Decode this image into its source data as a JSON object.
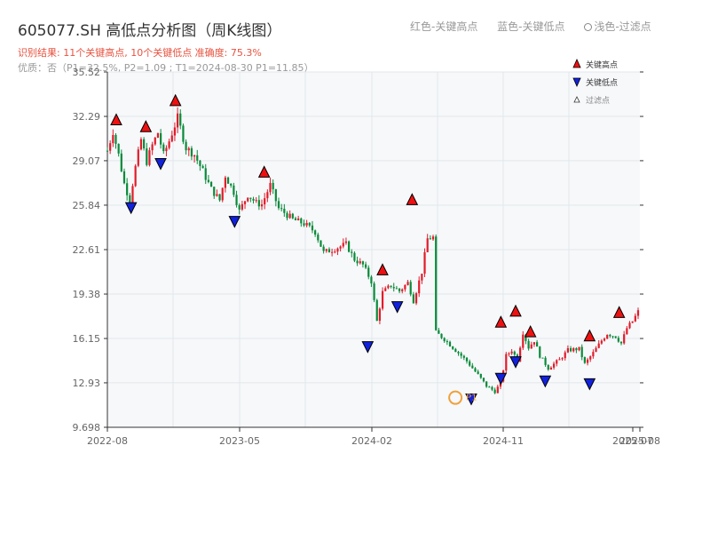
{
  "title": "605077.SH 高低点分析图（周K线图）",
  "summary": "识别结果: 11个关键高点, 10个关键低点   准确度: 75.3%",
  "quality": "优质：否（P1=32.5%, P2=1.09 ; T1=2024-08-30 P1=11.85）",
  "top_legend": {
    "red": "红色-关键高点",
    "blue": "蓝色-关键低点",
    "light": "浅色-过滤点"
  },
  "colors": {
    "up": "#e21b2a",
    "down": "#0a8a3a",
    "high_marker": "#ee1111",
    "low_marker": "#1122dd",
    "highlight": "#f0a03a",
    "grid": "#e3e7ec",
    "plot_bg": "#f6f8fa"
  },
  "chart_data": {
    "type": "candlestick",
    "x_ticks": [
      "2022-08",
      "2023-05",
      "2024-02",
      "2024-11",
      "2025-07",
      "2025-08"
    ],
    "y_ticks": [
      9.698,
      12.93,
      16.15,
      19.38,
      22.61,
      25.84,
      29.07,
      32.29,
      35.52
    ],
    "ylim": [
      9.698,
      35.52
    ],
    "legend": [
      "关键高点",
      "关键低点",
      "过滤点"
    ],
    "legend_position": "top-right",
    "grid": true,
    "price_path": [
      [
        0,
        29.8
      ],
      [
        2,
        31.2
      ],
      [
        4,
        29.5
      ],
      [
        6,
        27.4
      ],
      [
        8,
        26.2
      ],
      [
        10,
        28.6
      ],
      [
        12,
        30.6
      ],
      [
        14,
        29.0
      ],
      [
        16,
        30.2
      ],
      [
        18,
        31.1
      ],
      [
        20,
        29.5
      ],
      [
        22,
        30.5
      ],
      [
        25,
        32.2
      ],
      [
        28,
        30.0
      ],
      [
        31,
        29.5
      ],
      [
        34,
        28.3
      ],
      [
        37,
        27.0
      ],
      [
        40,
        26.2
      ],
      [
        42,
        28.0
      ],
      [
        45,
        26.8
      ],
      [
        47,
        25.4
      ],
      [
        50,
        26.6
      ],
      [
        53,
        26.0
      ],
      [
        55,
        25.9
      ],
      [
        58,
        27.3
      ],
      [
        61,
        25.6
      ],
      [
        63,
        25.3
      ],
      [
        66,
        24.8
      ],
      [
        70,
        24.5
      ],
      [
        74,
        23.9
      ],
      [
        77,
        22.4
      ],
      [
        80,
        22.6
      ],
      [
        85,
        23.0
      ],
      [
        88,
        21.9
      ],
      [
        91,
        21.5
      ],
      [
        94,
        20.3
      ],
      [
        96,
        17.4
      ],
      [
        98,
        19.5
      ],
      [
        101,
        20.0
      ],
      [
        104,
        19.6
      ],
      [
        107,
        20.2
      ],
      [
        109,
        18.9
      ],
      [
        112,
        21.0
      ],
      [
        114,
        23.4
      ],
      [
        116,
        23.5
      ],
      [
        117,
        16.6
      ],
      [
        120,
        16.1
      ],
      [
        124,
        15.3
      ],
      [
        128,
        14.5
      ],
      [
        132,
        13.5
      ],
      [
        135,
        12.7
      ],
      [
        138,
        12.3
      ],
      [
        140,
        12.9
      ],
      [
        142,
        14.9
      ],
      [
        144,
        15.3
      ],
      [
        146,
        14.6
      ],
      [
        148,
        16.6
      ],
      [
        150,
        15.5
      ],
      [
        152,
        16.0
      ],
      [
        154,
        14.9
      ],
      [
        157,
        14.0
      ],
      [
        161,
        14.6
      ],
      [
        164,
        15.3
      ],
      [
        168,
        15.4
      ],
      [
        170,
        14.3
      ],
      [
        173,
        15.1
      ],
      [
        176,
        16.0
      ],
      [
        178,
        16.5
      ],
      [
        181,
        16.3
      ],
      [
        183,
        15.8
      ],
      [
        185,
        16.9
      ],
      [
        187,
        17.4
      ],
      [
        189,
        18.1
      ]
    ],
    "key_highs": [
      {
        "date": "2022-08",
        "value": 32.0
      },
      {
        "date": "2022-10",
        "value": 31.5
      },
      {
        "date": "2022-12",
        "value": 33.4
      },
      {
        "date": "2023-06",
        "value": 28.2
      },
      {
        "date": "2024-02",
        "value": 21.1
      },
      {
        "date": "2024-04",
        "value": 26.2
      },
      {
        "date": "2024-10",
        "value": 17.3
      },
      {
        "date": "2024-11",
        "value": 18.1
      },
      {
        "date": "2024-12",
        "value": 16.6
      },
      {
        "date": "2025-04",
        "value": 16.3
      },
      {
        "date": "2025-06",
        "value": 18.0
      }
    ],
    "key_lows": [
      {
        "date": "2022-09",
        "value": 25.7
      },
      {
        "date": "2022-11",
        "value": 28.9
      },
      {
        "date": "2023-04",
        "value": 24.7
      },
      {
        "date": "2024-01",
        "value": 15.6
      },
      {
        "date": "2024-03",
        "value": 18.5
      },
      {
        "date": "2024-08",
        "value": 11.8
      },
      {
        "date": "2024-10",
        "value": 13.3
      },
      {
        "date": "2024-11",
        "value": 14.5
      },
      {
        "date": "2025-01",
        "value": 13.1
      },
      {
        "date": "2025-04",
        "value": 12.9
      }
    ],
    "highlight_point": {
      "label": "P1",
      "date": "2024-08-30",
      "value": 11.85
    }
  }
}
